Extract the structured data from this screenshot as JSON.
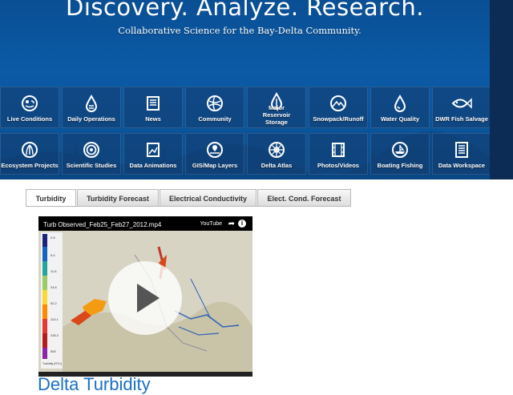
{
  "hero": {
    "title": "Discovery. Analyze. Research.",
    "subtitle": "Collaborative Science for the Bay-Delta Community."
  },
  "tiles": [
    {
      "label": "Live Conditions",
      "icon": "live-conditions-icon"
    },
    {
      "label": "Daily Operations",
      "icon": "water-drop-icon"
    },
    {
      "label": "News",
      "icon": "news-icon"
    },
    {
      "label": "Community",
      "icon": "community-icon"
    },
    {
      "label": "Major Reservoir Storage",
      "icon": "reservoir-drop-icon"
    },
    {
      "label": "Snowpack/Runoff",
      "icon": "mountain-icon"
    },
    {
      "label": "Water Quality",
      "icon": "water-quality-drop-icon"
    },
    {
      "label": "DWR Fish Salvage",
      "icon": "fish-icon"
    },
    {
      "label": "Ecosystem Projects",
      "icon": "ecosystem-icon"
    },
    {
      "label": "Scientific Studies",
      "icon": "target-icon"
    },
    {
      "label": "Data Animations",
      "icon": "chart-icon"
    },
    {
      "label": "GIS/Map Layers",
      "icon": "map-pin-icon"
    },
    {
      "label": "Delta Atlas",
      "icon": "compass-icon"
    },
    {
      "label": "Photos/Videos",
      "icon": "film-icon"
    },
    {
      "label": "Boating Fishing",
      "icon": "boat-icon"
    },
    {
      "label": "Data Workspace",
      "icon": "document-icon"
    }
  ],
  "tabs": [
    {
      "label": "Turbidity",
      "active": true
    },
    {
      "label": "Turbidity Forecast",
      "active": false
    },
    {
      "label": "Electrical Conductivity",
      "active": false
    },
    {
      "label": "Elect. Cond. Forecast",
      "active": false
    }
  ],
  "video": {
    "title": "Turb Observed_Feb25_Feb27_2012.mp4",
    "provider": "YouTube",
    "legend_values": [
      "2.8",
      "5.4",
      "11.8",
      "24.6",
      "52.2",
      "113.1",
      "235.2",
      "500"
    ],
    "legend_caption": "Turbidity (NTU)"
  },
  "section_heading": "Delta Turbidity",
  "colors": {
    "hero_blue": "#0b5aa6",
    "link_blue": "#1a6fc4"
  }
}
